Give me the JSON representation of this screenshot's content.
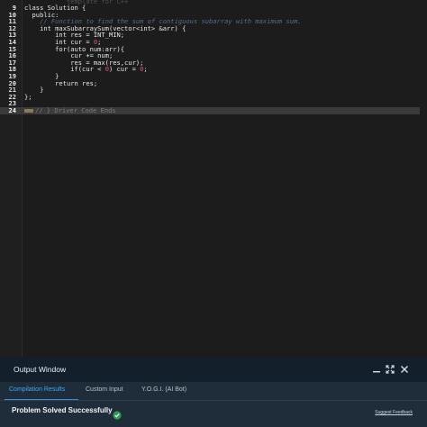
{
  "editor": {
    "lines": [
      {
        "n": "",
        "html": "<span class=\"faded\">           template for C++</span>"
      },
      {
        "n": "9",
        "html": "class Solution {"
      },
      {
        "n": "10",
        "html": "  public:"
      },
      {
        "n": "11",
        "html": "    <span class=\"comment\">// Function to find the sum of contiguous subarray with maximum sum.</span>"
      },
      {
        "n": "12",
        "html": "    int maxSubarraySum(vector&lt;int&gt; &amp;arr) {"
      },
      {
        "n": "13",
        "html": "        int res = INT_MIN;"
      },
      {
        "n": "14",
        "html": "        int cur = <span class=\"number\">0</span>;"
      },
      {
        "n": "15",
        "html": "        for(auto num:arr){"
      },
      {
        "n": "16",
        "html": "            cur += num;"
      },
      {
        "n": "17",
        "html": "            res = max(res,cur);"
      },
      {
        "n": "18",
        "html": "            if(cur &lt; <span class=\"number\">0</span>) cur = <span class=\"number\">0</span>;"
      },
      {
        "n": "19",
        "html": "        }"
      },
      {
        "n": "20",
        "html": "        return res;"
      },
      {
        "n": "21",
        "html": "    }"
      },
      {
        "n": "22",
        "html": "};"
      },
      {
        "n": "23",
        "html": ""
      },
      {
        "n": "24",
        "html": "<span class=\"caret-block\"></span>// } Driver Code Ends",
        "active": true
      }
    ]
  },
  "output_window": {
    "title": "Output Window",
    "tabs": [
      "Compilation Results",
      "Custom Input",
      "Y.O.G.I. (AI Bot)"
    ],
    "active_tab": 0,
    "result": "Problem Solved Successfully",
    "feedback_link": "Suggest Feedback"
  },
  "colors": {
    "accent": "#3fa8f4",
    "success": "#2e9b4e"
  },
  "icons": [
    "minimize-icon",
    "expand-icon",
    "close-icon",
    "check-circle-icon"
  ]
}
